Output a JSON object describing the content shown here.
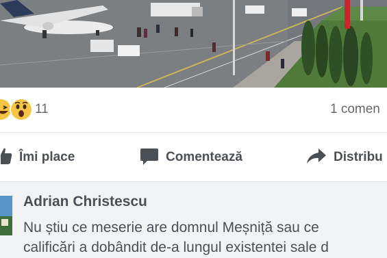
{
  "post": {
    "photo_alt": "",
    "reaction_count": "11",
    "reaction_icons": [
      "haha-emoji",
      "wow-emoji"
    ],
    "comment_count": "1 comen"
  },
  "actions": {
    "like_label": "Îmi place",
    "comment_label": "Comentează",
    "share_label": "Distribu"
  },
  "comment": {
    "author": "Adrian Christescu",
    "line1": "Nu știu ce meserie are domnul Meșniță sau ce",
    "line2": "calificări a dobândit de-a lungul existentei sale d"
  },
  "colors": {
    "text_secondary": "#65676b",
    "text_primary": "#4b4f56",
    "comment_bg": "#f2f3f5",
    "emoji_yellow": "#f7c544"
  }
}
